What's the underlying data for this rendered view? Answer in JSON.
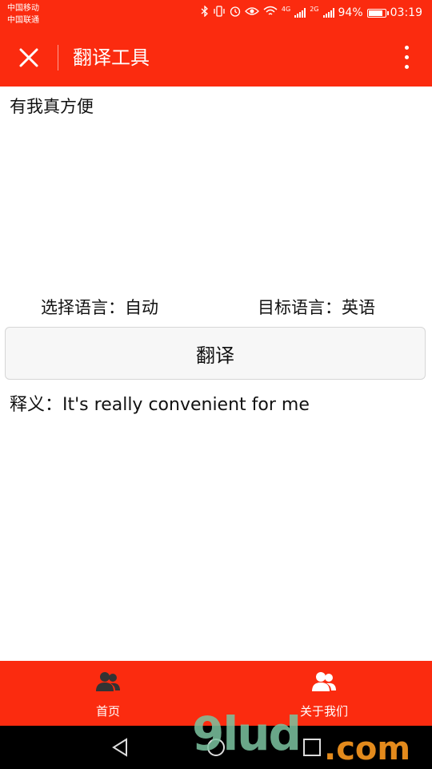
{
  "status_bar": {
    "carrier_1": "中国移动",
    "carrier_2": "中国联通",
    "network_1": "4G",
    "network_2": "2G",
    "battery": "94%",
    "battery_level": 0.94,
    "time": "03:19",
    "icons": [
      "bluetooth-icon",
      "vibrate-icon",
      "alarm-icon",
      "eye-icon",
      "wifi-icon",
      "signal-icon",
      "signal-icon",
      "battery-icon"
    ]
  },
  "header": {
    "title": "翻译工具",
    "close_icon": "close-icon",
    "more_icon": "more-vertical-icon"
  },
  "input": {
    "source_text": "有我真方便"
  },
  "language": {
    "source_label": "选择语言：",
    "source_value": "自动",
    "target_label": "目标语言：",
    "target_value": "英语"
  },
  "translate_button": "翻译",
  "result": {
    "label": "释义：",
    "text": "It's really convenient for me"
  },
  "tabs": [
    {
      "label": "首页",
      "icon": "users-icon"
    },
    {
      "label": "关于我们",
      "icon": "users-icon"
    }
  ],
  "watermark": {
    "brand": "9lud",
    "domain": ".com"
  },
  "colors": {
    "accent": "#fb2b0f",
    "button_bg": "#f7f7f7",
    "nav_bg": "#000000"
  }
}
